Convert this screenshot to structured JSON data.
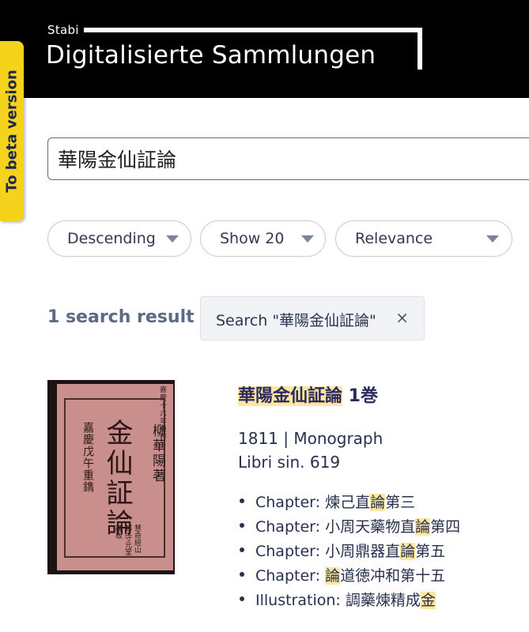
{
  "header": {
    "logo_small": "Stabi",
    "logo_title": "Digitalisierte Sammlungen",
    "bg_color": "#000000"
  },
  "beta_tab": {
    "label": "To beta version",
    "color": "#f5d21c"
  },
  "search": {
    "value": "華陽金仙証論"
  },
  "controls": {
    "order": "Descending",
    "per_page": "Show 20",
    "sort": "Relevance"
  },
  "results_bar": {
    "count": "1 search result",
    "filter_chip": "Search \"華陽金仙証論\"",
    "filter_close": "×"
  },
  "result": {
    "title_highlight": "華陽金仙証論",
    "title_rest": " 1巻",
    "meta_line_1": "1811 | Monograph",
    "meta_line_2": "Libri sin. 619",
    "highlight_color": "#fde7a2",
    "thumbnail": {
      "top_caption": "嘉慶十六年重梓",
      "big_title": "金仙証論",
      "right_text": "柳華陽著",
      "left_text": "嘉慶戊午重鐫",
      "bottom_text": "慧命經山邨 守元堂藏板"
    },
    "chapters": [
      {
        "prefix": "Chapter: ",
        "pre": "煉己直",
        "hl": "論",
        "post": "第三"
      },
      {
        "prefix": "Chapter: ",
        "pre": "小周天藥物直",
        "hl": "論",
        "post": "第四"
      },
      {
        "prefix": "Chapter: ",
        "pre": "小周鼎器直",
        "hl": "論",
        "post": "第五"
      },
      {
        "prefix": "Chapter: ",
        "pre": "",
        "hl": "論",
        "post": "道徳冲和第十五"
      },
      {
        "prefix": "Illustration: ",
        "pre": "調藥煉精成",
        "hl": "金",
        "post": ""
      }
    ]
  }
}
